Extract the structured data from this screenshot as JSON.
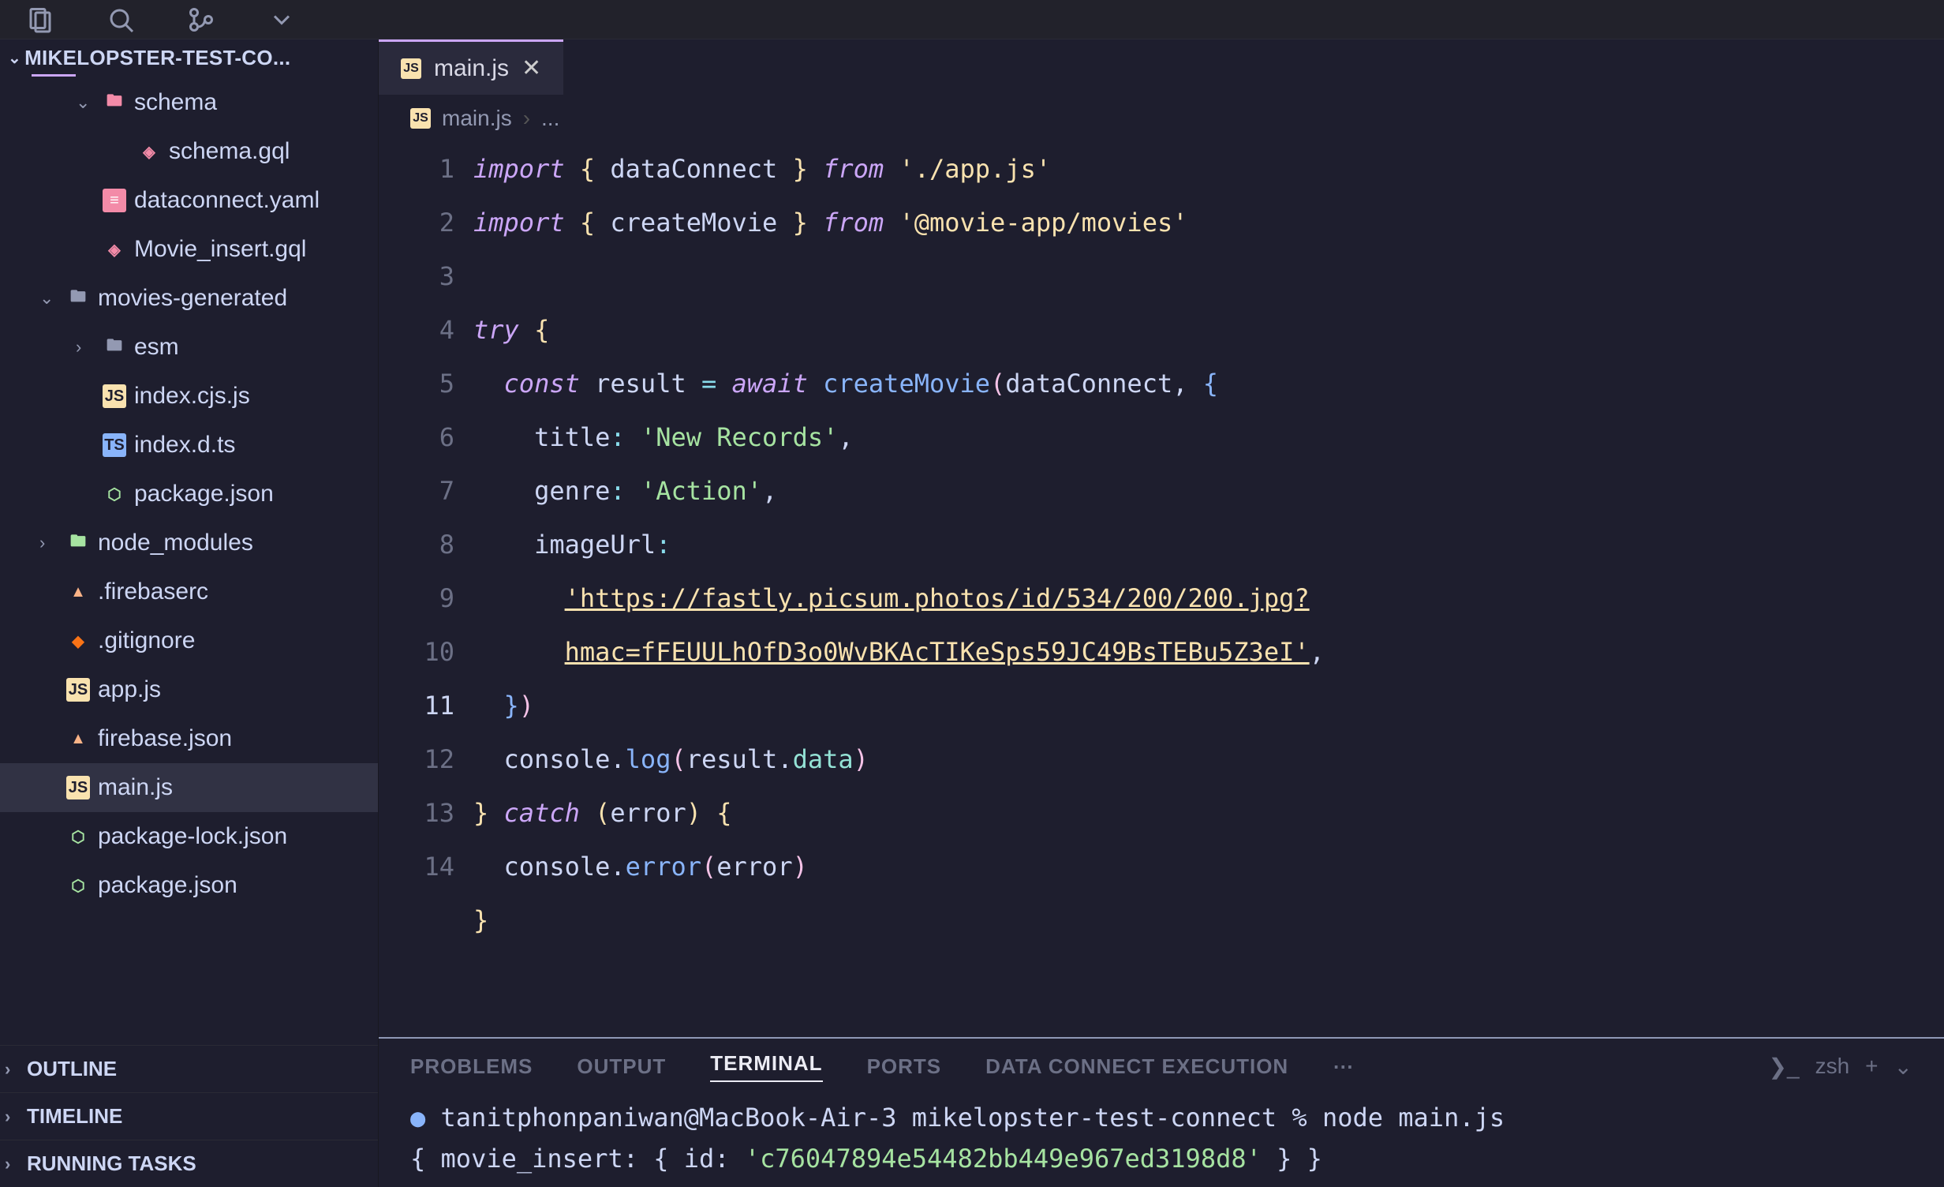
{
  "titlebar": {
    "icons": [
      "files",
      "search",
      "git",
      "chevron-down"
    ]
  },
  "explorer": {
    "title": "MIKELOPSTER-TEST-CO...",
    "tree": [
      {
        "indent": 1,
        "twist": "v",
        "icon": "folder-red",
        "name": "schema",
        "bold": false
      },
      {
        "indent": 2,
        "twist": "",
        "icon": "gql",
        "name": "schema.gql"
      },
      {
        "indent": 1,
        "twist": "",
        "icon": "yaml",
        "name": "dataconnect.yaml"
      },
      {
        "indent": 1,
        "twist": "",
        "icon": "gql",
        "name": "Movie_insert.gql"
      },
      {
        "indent": 0,
        "twist": "v",
        "icon": "folder",
        "name": "movies-generated"
      },
      {
        "indent": 1,
        "twist": ">",
        "icon": "folder",
        "name": "esm"
      },
      {
        "indent": 1,
        "twist": "",
        "icon": "js",
        "name": "index.cjs.js"
      },
      {
        "indent": 1,
        "twist": "",
        "icon": "ts",
        "name": "index.d.ts"
      },
      {
        "indent": 1,
        "twist": "",
        "icon": "node",
        "name": "package.json"
      },
      {
        "indent": 0,
        "twist": ">",
        "icon": "folder-green",
        "name": "node_modules"
      },
      {
        "indent": 0,
        "twist": "",
        "icon": "firebase",
        "name": ".firebaserc"
      },
      {
        "indent": 0,
        "twist": "",
        "icon": "git",
        "name": ".gitignore"
      },
      {
        "indent": 0,
        "twist": "",
        "icon": "js",
        "name": "app.js"
      },
      {
        "indent": 0,
        "twist": "",
        "icon": "firebase",
        "name": "firebase.json"
      },
      {
        "indent": 0,
        "twist": "",
        "icon": "js",
        "name": "main.js",
        "selected": true
      },
      {
        "indent": 0,
        "twist": "",
        "icon": "node",
        "name": "package-lock.json"
      },
      {
        "indent": 0,
        "twist": "",
        "icon": "node",
        "name": "package.json"
      }
    ],
    "sections": [
      "OUTLINE",
      "TIMELINE",
      "RUNNING TASKS"
    ]
  },
  "tab": {
    "file": "main.js"
  },
  "breadcrumb": {
    "file": "main.js",
    "rest": "..."
  },
  "code": {
    "lines": [
      {
        "n": 1,
        "html": "<span class='kw'>import</span> <span class='brace-y'>{</span> <span class='prop'>dataConnect</span> <span class='brace-y'>}</span> <span class='kw'>from</span> <span class='str-y'>'./app.js'</span>"
      },
      {
        "n": 2,
        "html": "<span class='kw'>import</span> <span class='brace-y'>{</span> <span class='prop'>createMovie</span> <span class='brace-y'>}</span> <span class='kw'>from</span> <span class='str-y'>'@movie-app/movies'</span>"
      },
      {
        "n": 3,
        "html": ""
      },
      {
        "n": 4,
        "html": "<span class='kw'>try</span> <span class='brace-y'>{</span>"
      },
      {
        "n": 5,
        "html": "  <span class='kw'>const</span> <span class='prop'>result</span> <span class='op'>=</span> <span class='kw'>await</span> <span class='fn'>createMovie</span><span class='brace-p'>(</span><span class='prop'>dataConnect</span>, <span class='brace-b'>{</span>"
      },
      {
        "n": 6,
        "html": "    <span class='prop'>title</span><span class='op'>:</span> <span class='str'>'New Records'</span>,"
      },
      {
        "n": 7,
        "html": "    <span class='prop'>genre</span><span class='op'>:</span> <span class='str'>'Action'</span>,"
      },
      {
        "n": 8,
        "html": "    <span class='prop'>imageUrl</span><span class='op'>:</span>"
      },
      {
        "n": 9,
        "html": "      <span class='url'>'https://fastly.picsum.photos/id/534/200/200.jpg?</span>"
      },
      {
        "n": "",
        "html": "      <span class='url'>hmac=fFEUULhOfD3o0WvBKAcTIKeSps59JC49BsTEBu5Z3eI'</span>,"
      },
      {
        "n": 10,
        "html": "  <span class='brace-b'>}</span><span class='brace-p'>)</span>"
      },
      {
        "n": 11,
        "html": "  <span class='prop'>console</span>.<span class='fn'>log</span><span class='brace-p'>(</span><span class='prop'>result</span>.<span class='id'>data</span><span class='brace-p'>)</span>",
        "current": true
      },
      {
        "n": 12,
        "html": "<span class='brace-y'>}</span> <span class='kw'>catch</span> <span class='brace-y'>(</span><span class='prop'>error</span><span class='brace-y'>)</span> <span class='brace-y'>{</span>"
      },
      {
        "n": 13,
        "html": "  <span class='prop'>console</span>.<span class='fn'>error</span><span class='brace-p'>(</span><span class='prop'>error</span><span class='brace-p'>)</span>"
      },
      {
        "n": 14,
        "html": "<span class='brace-y'>}</span>"
      }
    ]
  },
  "panel": {
    "tabs": [
      "PROBLEMS",
      "OUTPUT",
      "TERMINAL",
      "PORTS",
      "DATA CONNECT EXECUTION"
    ],
    "active": "TERMINAL",
    "more": "⋯",
    "shell": "zsh",
    "terminal": [
      {
        "html": "<span class='bullet'>●</span> tanitphonpaniwan@MacBook-Air-3 mikelopster-test-connect % node main.js"
      },
      {
        "html": "  { movie_insert: { id: <span class='prompt-green'>'c76047894e54482bb449e967ed3198d8'</span> } }"
      }
    ]
  },
  "icons": {
    "js": {
      "bg": "#f9e2af",
      "fg": "#1e1e2e",
      "txt": "JS"
    },
    "ts": {
      "bg": "#89b4fa",
      "fg": "#1e1e2e",
      "txt": "TS"
    },
    "gql": {
      "bg": "transparent",
      "fg": "#f38ba8",
      "txt": "◈"
    },
    "yaml": {
      "bg": "#f38ba8",
      "fg": "#fff",
      "txt": "≡"
    },
    "folder": {
      "bg": "transparent",
      "fg": "#9399b2",
      "txt": "🖿"
    },
    "folder-red": {
      "bg": "transparent",
      "fg": "#f38ba8",
      "txt": "🖿"
    },
    "folder-green": {
      "bg": "transparent",
      "fg": "#a6e3a1",
      "txt": "🖿"
    },
    "node": {
      "bg": "transparent",
      "fg": "#a6e3a1",
      "txt": "⬡"
    },
    "firebase": {
      "bg": "transparent",
      "fg": "#fab387",
      "txt": "▲"
    },
    "git": {
      "bg": "transparent",
      "fg": "#f97316",
      "txt": "◆"
    }
  }
}
